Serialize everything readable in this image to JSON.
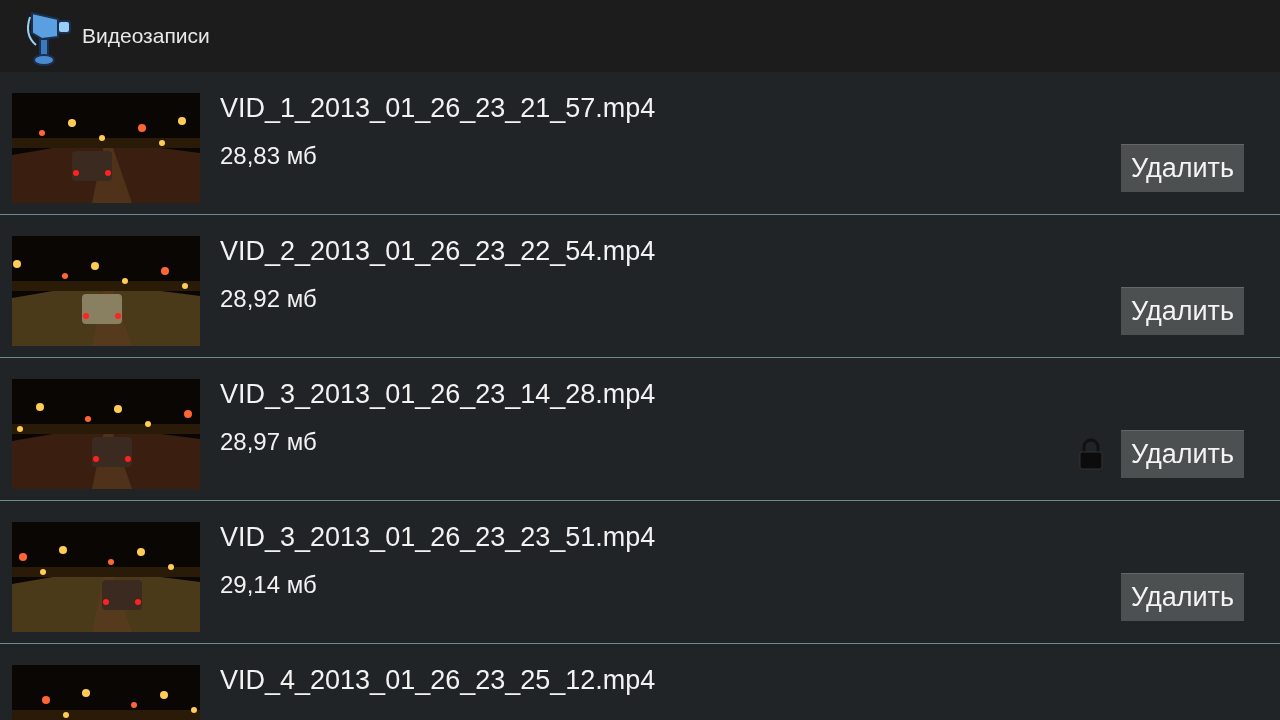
{
  "app_bar": {
    "title": "Видеозаписи"
  },
  "videos": [
    {
      "name": "VID_1_2013_01_26_23_21_57.mp4",
      "size": "28,83 мб",
      "locked": false,
      "button": "Удалить"
    },
    {
      "name": "VID_2_2013_01_26_23_22_54.mp4",
      "size": "28,92 мб",
      "locked": false,
      "button": "Удалить"
    },
    {
      "name": "VID_3_2013_01_26_23_14_28.mp4",
      "size": "28,97 мб",
      "locked": true,
      "button": "Удалить"
    },
    {
      "name": "VID_3_2013_01_26_23_23_51.mp4",
      "size": "29,14 мб",
      "locked": false,
      "button": "Удалить"
    },
    {
      "name": "VID_4_2013_01_26_23_25_12.mp4",
      "locked": false
    }
  ]
}
